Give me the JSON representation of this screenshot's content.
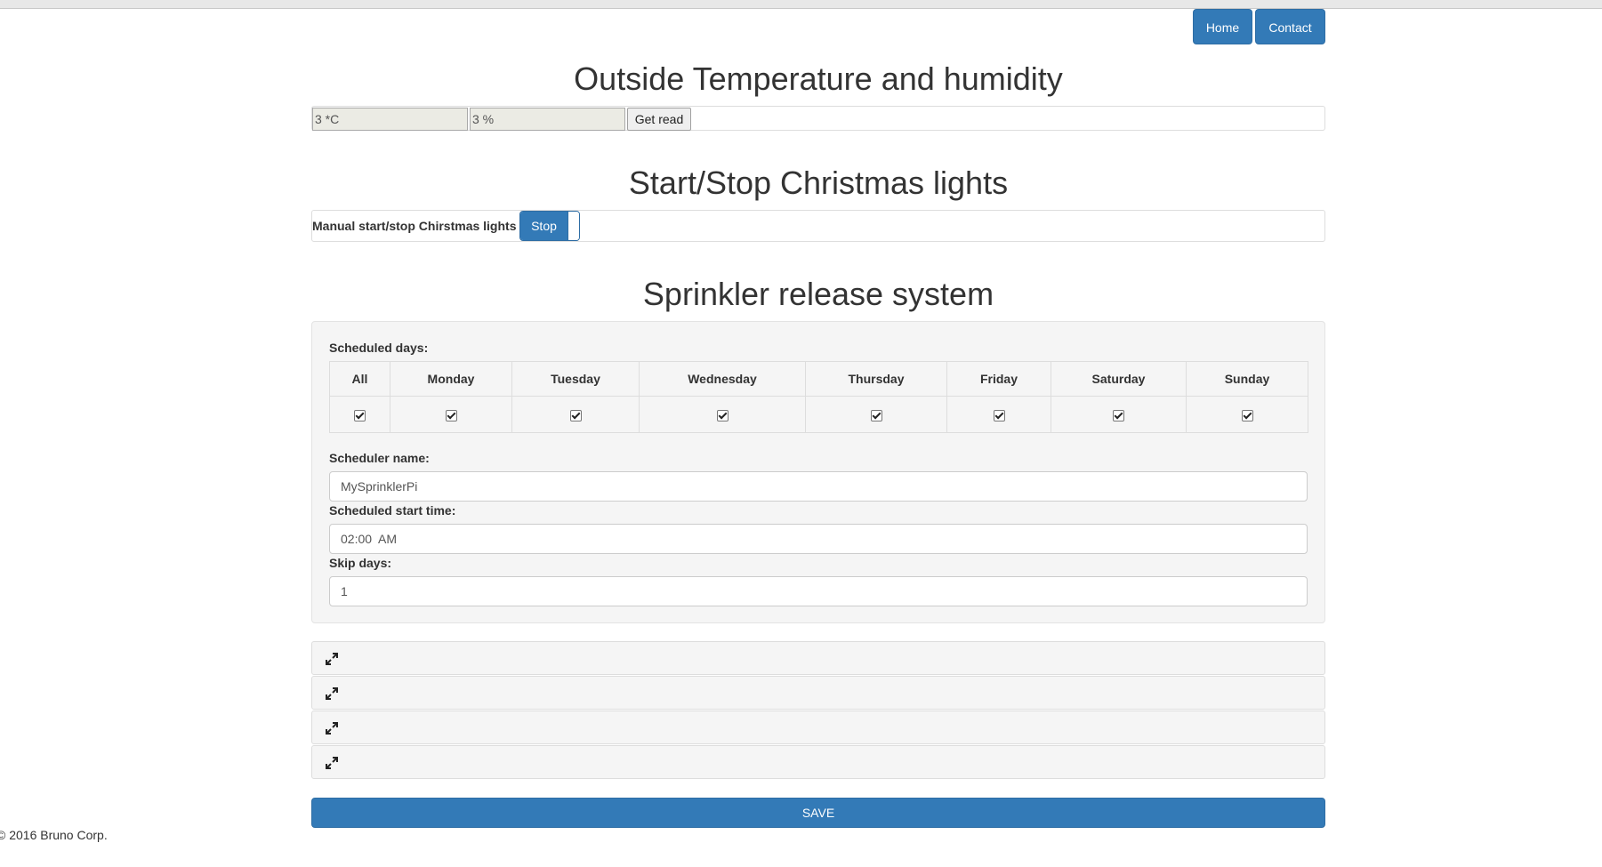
{
  "nav": {
    "home_label": "Home",
    "contact_label": "Contact"
  },
  "temperature": {
    "title": "Outside Temperature and humidity",
    "temp_value": "3 *C",
    "humidity_value": "3 %",
    "get_read_label": "Get read"
  },
  "lights": {
    "title": "Start/Stop Christmas lights",
    "label": "Manual start/stop Chirstmas lights",
    "toggle_label": "Stop"
  },
  "sprinkler": {
    "title": "Sprinkler release system",
    "scheduled_days_label": "Scheduled days:",
    "days": [
      {
        "label": "All",
        "checked": true
      },
      {
        "label": "Monday",
        "checked": true
      },
      {
        "label": "Tuesday",
        "checked": true
      },
      {
        "label": "Wednesday",
        "checked": true
      },
      {
        "label": "Thursday",
        "checked": true
      },
      {
        "label": "Friday",
        "checked": true
      },
      {
        "label": "Saturday",
        "checked": true
      },
      {
        "label": "Sunday",
        "checked": true
      }
    ],
    "scheduler_name_label": "Scheduler name:",
    "scheduler_name_value": "MySprinklerPi",
    "start_time_label": "Scheduled start time:",
    "start_time_value": "02:00  AM",
    "skip_days_label": "Skip days:",
    "skip_days_value": "1"
  },
  "collapsible_icons": [
    "expand-icon",
    "expand-icon",
    "expand-icon",
    "expand-icon"
  ],
  "save_label": "SAVE",
  "footer_text": "© 2016 Bruno Corp.",
  "colors": {
    "primary": "#337ab7",
    "panel_bg": "#f5f5f5"
  }
}
